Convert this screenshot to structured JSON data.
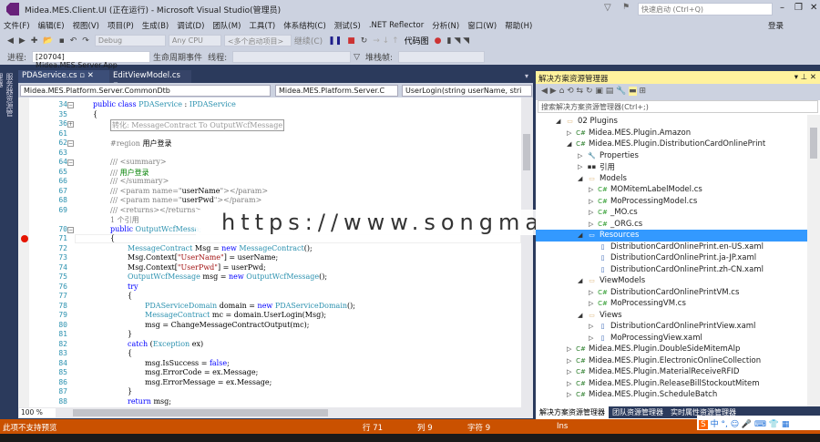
{
  "window": {
    "title": "Midea.MES.Client.UI (正在运行) - Microsoft Visual Studio(管理员)",
    "quick_launch": "快速启动 (Ctrl+Q)",
    "login": "登录"
  },
  "menu": [
    "文件(F)",
    "编辑(E)",
    "视图(V)",
    "项目(P)",
    "生成(B)",
    "调试(D)",
    "团队(M)",
    "工具(T)",
    "体系结构(C)",
    "测试(S)",
    ".NET Reflector",
    "分析(N)",
    "窗口(W)",
    "帮助(H)"
  ],
  "toolbar": {
    "config": "Debug",
    "platform": "Any CPU",
    "startup": "<多个启动项目>",
    "continue": "继续(C)",
    "codemap": "代码图",
    "process_label": "进程:",
    "process": "[20704] Midea.MES.Server.App",
    "lifecycle": "生命周期事件",
    "thread_label": "线程:",
    "stack_label": "堆栈帧:"
  },
  "left_tab": "服务器资源管理器",
  "doc_tabs": [
    "PDAService.cs",
    "EditViewModel.cs"
  ],
  "nav": {
    "project": "Midea.MES.Platform.Server.CommonDtb",
    "class": "Midea.MES.Platform.Server.C",
    "member": "UserLogin(string userName, stri"
  },
  "code": [
    {
      "n": "34",
      "f": "-",
      "s": [
        [
          "k",
          "public class "
        ],
        [
          "t",
          "PDAService"
        ],
        [
          "x",
          " : "
        ],
        [
          "t",
          "IPDAService"
        ]
      ],
      "i": 0
    },
    {
      "n": "35",
      "s": [
        [
          "x",
          "{"
        ]
      ],
      "i": 0
    },
    {
      "n": "36",
      "f": "+",
      "s": [
        [
          "r",
          "转化: MessageContract To OutputWcfMessage"
        ]
      ],
      "i": 1
    },
    {
      "n": "61",
      "s": [],
      "i": 1
    },
    {
      "n": "62",
      "f": "-",
      "s": [
        [
          "c",
          "#region "
        ],
        [
          "x",
          "用户登录"
        ]
      ],
      "i": 1
    },
    {
      "n": "63",
      "s": [],
      "i": 1
    },
    {
      "n": "64",
      "f": "-",
      "s": [
        [
          "c",
          "/// <summary>"
        ]
      ],
      "i": 1
    },
    {
      "n": "65",
      "s": [
        [
          "c",
          "/// "
        ],
        [
          "g",
          "用户登录"
        ]
      ],
      "i": 1
    },
    {
      "n": "66",
      "s": [
        [
          "c",
          "/// </summary>"
        ]
      ],
      "i": 1
    },
    {
      "n": "67",
      "s": [
        [
          "c",
          "/// <param name=\""
        ],
        [
          "x",
          "userName"
        ],
        [
          "c",
          "\"></param>"
        ]
      ],
      "i": 1
    },
    {
      "n": "68",
      "s": [
        [
          "c",
          "/// <param name=\""
        ],
        [
          "x",
          "userPwd"
        ],
        [
          "c",
          "\"></param>"
        ]
      ],
      "i": 1
    },
    {
      "n": "69",
      "s": [
        [
          "c",
          "/// <returns></returns>"
        ]
      ],
      "i": 1
    },
    {
      "n": "",
      "s": [
        [
          "c",
          "1 个引用"
        ]
      ],
      "i": 1
    },
    {
      "n": "70",
      "f": "-",
      "s": [
        [
          "k",
          "public "
        ],
        [
          "t",
          "OutputWcfMessa;"
        ]
      ],
      "i": 1
    },
    {
      "n": "71",
      "bp": true,
      "s": [
        [
          "x",
          "{"
        ]
      ],
      "i": 1
    },
    {
      "n": "72",
      "s": [
        [
          "t",
          "MessageContract"
        ],
        [
          "x",
          " Msg = "
        ],
        [
          "k",
          "new "
        ],
        [
          "t",
          "MessageContract"
        ],
        [
          "x",
          "();"
        ]
      ],
      "i": 2
    },
    {
      "n": "73",
      "s": [
        [
          "x",
          "Msg.Context["
        ],
        [
          "s",
          "\"UserName\""
        ],
        [
          "x",
          "] = userName;"
        ]
      ],
      "i": 2
    },
    {
      "n": "74",
      "s": [
        [
          "x",
          "Msg.Context["
        ],
        [
          "s",
          "\"UserPwd\""
        ],
        [
          "x",
          "] = userPwd;"
        ]
      ],
      "i": 2
    },
    {
      "n": "75",
      "s": [
        [
          "t",
          "OutputWcfMessage"
        ],
        [
          "x",
          " msg = "
        ],
        [
          "k",
          "new "
        ],
        [
          "t",
          "OutputWcfMessage"
        ],
        [
          "x",
          "();"
        ]
      ],
      "i": 2
    },
    {
      "n": "76",
      "s": [
        [
          "k",
          "try"
        ]
      ],
      "i": 2
    },
    {
      "n": "77",
      "s": [
        [
          "x",
          "{"
        ]
      ],
      "i": 2
    },
    {
      "n": "78",
      "s": [
        [
          "t",
          "PDAServiceDomain"
        ],
        [
          "x",
          " domain = "
        ],
        [
          "k",
          "new "
        ],
        [
          "t",
          "PDAServiceDomain"
        ],
        [
          "x",
          "();"
        ]
      ],
      "i": 3
    },
    {
      "n": "79",
      "s": [
        [
          "t",
          "MessageContract"
        ],
        [
          "x",
          " mc = domain.UserLogin(Msg);"
        ]
      ],
      "i": 3
    },
    {
      "n": "80",
      "s": [
        [
          "x",
          "msg = ChangeMessageContractOutput(mc);"
        ]
      ],
      "i": 3
    },
    {
      "n": "81",
      "s": [
        [
          "x",
          "}"
        ]
      ],
      "i": 2
    },
    {
      "n": "82",
      "s": [
        [
          "k",
          "catch "
        ],
        [
          "x",
          "("
        ],
        [
          "t",
          "Exception"
        ],
        [
          "x",
          " ex)"
        ]
      ],
      "i": 2
    },
    {
      "n": "83",
      "s": [
        [
          "x",
          "{"
        ]
      ],
      "i": 2
    },
    {
      "n": "84",
      "s": [
        [
          "x",
          "msg.IsSuccess = "
        ],
        [
          "k",
          "false"
        ],
        [
          "x",
          ";"
        ]
      ],
      "i": 3
    },
    {
      "n": "85",
      "s": [
        [
          "x",
          "msg.ErrorCode = ex.Message;"
        ]
      ],
      "i": 3
    },
    {
      "n": "86",
      "s": [
        [
          "x",
          "msg.ErrorMessage = ex.Message;"
        ]
      ],
      "i": 3
    },
    {
      "n": "87",
      "s": [
        [
          "x",
          "}"
        ]
      ],
      "i": 2
    },
    {
      "n": "88",
      "s": [
        [
          "k",
          "return "
        ],
        [
          "x",
          "msg;"
        ]
      ],
      "i": 2
    }
  ],
  "zoom": "100 %",
  "watermark": "https://www.songma.com",
  "solution_explorer": {
    "title": "解决方案资源管理器",
    "search_placeholder": "搜索解决方案资源管理器(Ctrl+;)",
    "tree": [
      {
        "l": 1,
        "e": "◢",
        "i": "folder",
        "t": "02 Plugins"
      },
      {
        "l": 2,
        "e": "▷",
        "i": "proj",
        "t": "Midea.MES.Plugin.Amazon"
      },
      {
        "l": 2,
        "e": "◢",
        "i": "proj",
        "t": "Midea.MES.Plugin.DistributionCardOnlinePrint"
      },
      {
        "l": 3,
        "e": "▷",
        "i": "wrench",
        "t": "Properties"
      },
      {
        "l": 3,
        "e": "▷",
        "i": "ref",
        "t": "引用"
      },
      {
        "l": 3,
        "e": "◢",
        "i": "folder",
        "t": "Models"
      },
      {
        "l": 4,
        "e": "▷",
        "i": "cs",
        "t": "MOMitemLabelModel.cs"
      },
      {
        "l": 4,
        "e": "▷",
        "i": "cs",
        "t": "MoProcessingModel.cs"
      },
      {
        "l": 4,
        "e": "▷",
        "i": "cs",
        "t": "_MO.cs"
      },
      {
        "l": 4,
        "e": "▷",
        "i": "cs",
        "t": "_ORG.cs"
      },
      {
        "l": 3,
        "e": "◢",
        "i": "folder",
        "t": "Resources",
        "sel": true
      },
      {
        "l": 4,
        "e": "",
        "i": "file",
        "t": "DistributionCardOnlinePrint.en-US.xaml"
      },
      {
        "l": 4,
        "e": "",
        "i": "file",
        "t": "DistributionCardOnlinePrint.ja-JP.xaml"
      },
      {
        "l": 4,
        "e": "",
        "i": "file",
        "t": "DistributionCardOnlinePrint.zh-CN.xaml"
      },
      {
        "l": 3,
        "e": "◢",
        "i": "folder",
        "t": "ViewModels"
      },
      {
        "l": 4,
        "e": "▷",
        "i": "cs",
        "t": "DistributionCardOnlinePrintVM.cs"
      },
      {
        "l": 4,
        "e": "▷",
        "i": "cs",
        "t": "MoProcessingVM.cs"
      },
      {
        "l": 3,
        "e": "◢",
        "i": "folder",
        "t": "Views"
      },
      {
        "l": 4,
        "e": "▷",
        "i": "file",
        "t": "DistributionCardOnlinePrintView.xaml"
      },
      {
        "l": 4,
        "e": "▷",
        "i": "file",
        "t": "MoProcessingView.xaml"
      },
      {
        "l": 2,
        "e": "▷",
        "i": "proj",
        "t": "Midea.MES.Plugin.DoubleSideMitemAlp"
      },
      {
        "l": 2,
        "e": "▷",
        "i": "proj",
        "t": "Midea.MES.Plugin.ElectronicOnlineCollection"
      },
      {
        "l": 2,
        "e": "▷",
        "i": "proj",
        "t": "Midea.MES.Plugin.MaterialReceiveRFID"
      },
      {
        "l": 2,
        "e": "▷",
        "i": "proj",
        "t": "Midea.MES.Plugin.ReleaseBillStockoutMitem"
      },
      {
        "l": 2,
        "e": "▷",
        "i": "proj",
        "t": "Midea.MES.Plugin.ScheduleBatch"
      }
    ],
    "tabs": [
      "解决方案资源管理器",
      "团队资源管理器",
      "实时属性资源管理器"
    ]
  },
  "status": {
    "message": "此项不支持预览",
    "row": "行 71",
    "col": "列 9",
    "char": "字符 9",
    "mode": "Ins"
  },
  "ime": {
    "lang": "中"
  }
}
